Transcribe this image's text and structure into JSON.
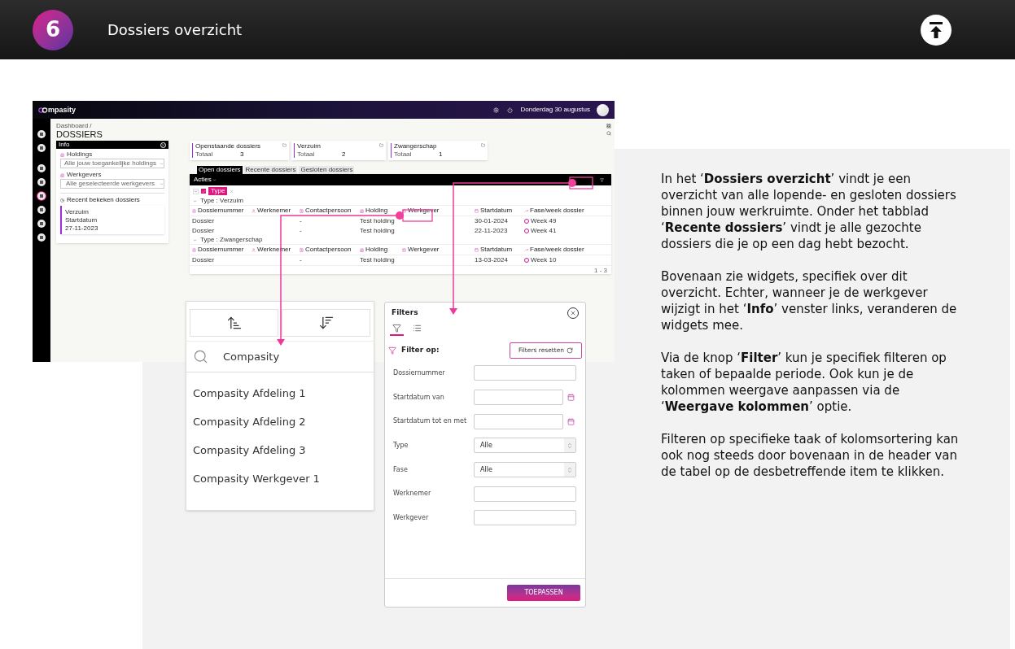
{
  "header": {
    "step": "6",
    "title": "Dossiers overzicht"
  },
  "app": {
    "logo": "mpasity",
    "date": "Donderdag 30 augustus",
    "sidebar": [
      {
        "selected": false
      },
      {
        "selected": false
      },
      {
        "selected": false
      },
      {
        "selected": false
      },
      {
        "selected": true
      },
      {
        "selected": false
      },
      {
        "selected": false
      },
      {
        "selected": false
      }
    ],
    "breadcrumb": "Dashboard /",
    "page_title": "DOSSIERS",
    "info_panel": {
      "title": "Info",
      "fields": [
        {
          "label": "Holdings",
          "placeholder": "Alle jouw toegankelijke holdings"
        },
        {
          "label": "Werkgevers",
          "placeholder": "Alle geselecteerde werkgevers"
        }
      ],
      "recent_title": "Recent bekeken dossiers",
      "recent_card": {
        "name": "Verzuim",
        "label": "Startdatum",
        "date": "27-11-2023"
      }
    },
    "widgets": [
      {
        "title": "Openstaande dossiers",
        "label": "Totaal",
        "count": "3"
      },
      {
        "title": "Verzuim",
        "label": "Totaal",
        "count": "2"
      },
      {
        "title": "Zwangerschap",
        "label": "Totaal",
        "count": "1"
      }
    ],
    "tabs": [
      {
        "label": "Open dossiers",
        "selected": true
      },
      {
        "label": "Recente dossiers",
        "selected": false
      },
      {
        "label": "Gesloten dossiers",
        "selected": false
      }
    ],
    "actions": "Acties",
    "group_checkbox": {
      "checked": true
    },
    "group_chip": "Type",
    "groups": [
      {
        "title": "Type : Verzuim",
        "columns": [
          "Dossiernummer",
          "Werknemer",
          "Contactpersoon",
          "Holding",
          "Werkgever",
          "Startdatum",
          "Fase/week dossier"
        ],
        "rows": [
          {
            "cells": [
              "Dossier",
              null,
              "-",
              "Test holding",
              null,
              "30-01-2024",
              "Week 49"
            ]
          },
          {
            "cells": [
              "Dossier",
              null,
              "-",
              "Test holding",
              null,
              "22-11-2023",
              "Week 41"
            ]
          }
        ]
      },
      {
        "title": "Type : Zwangerschap",
        "columns": [
          "Dossiernummer",
          "Werknemer",
          "Contactpersoon",
          "Holding",
          "Werkgever",
          "Startdatum",
          "Fase/week dossier"
        ],
        "rows": [
          {
            "cells": [
              "Dossier",
              null,
              "-",
              "Test holding",
              null,
              "13-03-2024",
              "Week 10"
            ]
          }
        ]
      }
    ],
    "pagination": "1 - 3"
  },
  "sort_panel": {
    "sort_buttons": [
      {
        "kind": "ascending"
      },
      {
        "kind": "descending"
      }
    ],
    "search_value": "Compasity",
    "items": [
      "Compasity Afdeling 1",
      "Compasity Afdeling 2",
      "Compasity Afdeling 3",
      "Compasity Werkgever 1"
    ]
  },
  "filter_panel": {
    "title": "Filters",
    "tabs": [
      {
        "kind": "filter",
        "selected": true
      },
      {
        "kind": "list",
        "selected": false
      }
    ],
    "heading": "Filter op:",
    "reset_button": "Filters resetten",
    "fields": [
      {
        "label": "Dossiernummer",
        "kind": "text"
      },
      {
        "label": "Startdatum van",
        "kind": "date"
      },
      {
        "label": "Startdatum tot en met",
        "kind": "date"
      },
      {
        "label": "Type",
        "kind": "select",
        "value": "Alle"
      },
      {
        "label": "Fase",
        "kind": "select",
        "value": "Alle"
      },
      {
        "label": "Werknemer",
        "kind": "text"
      },
      {
        "label": "Werkgever",
        "kind": "text"
      }
    ],
    "apply_button": "TOEPASSEN"
  },
  "description": [
    "In het ‘**Dossiers overzicht**’ vindt je een overzicht van alle lopende- en gesloten dossiers binnen jouw werkruimte. Onder het tabblad ‘**Recente dossiers**’ vindt je alle gezochte dossiers die je op een dag hebt bezocht.",
    "Bovenaan zie widgets, specifiek over dit overzicht. Echter, wanneer je de werkgever wijzigt in het ‘**Info**’ venster links, veranderen de widgets mee.",
    "Via de knop ‘**Filter**’ kun je specifiek filteren op taken of bepaalde periode. Ook kun je de kolommen weergave aanpassen via de ‘**Weergave kolommen**’ optie.",
    "Filteren op specifieke taak of kolomsortering kan ook nog steeds door bovenaan in de header van de tabel op de desbetreffende item te klikken."
  ]
}
